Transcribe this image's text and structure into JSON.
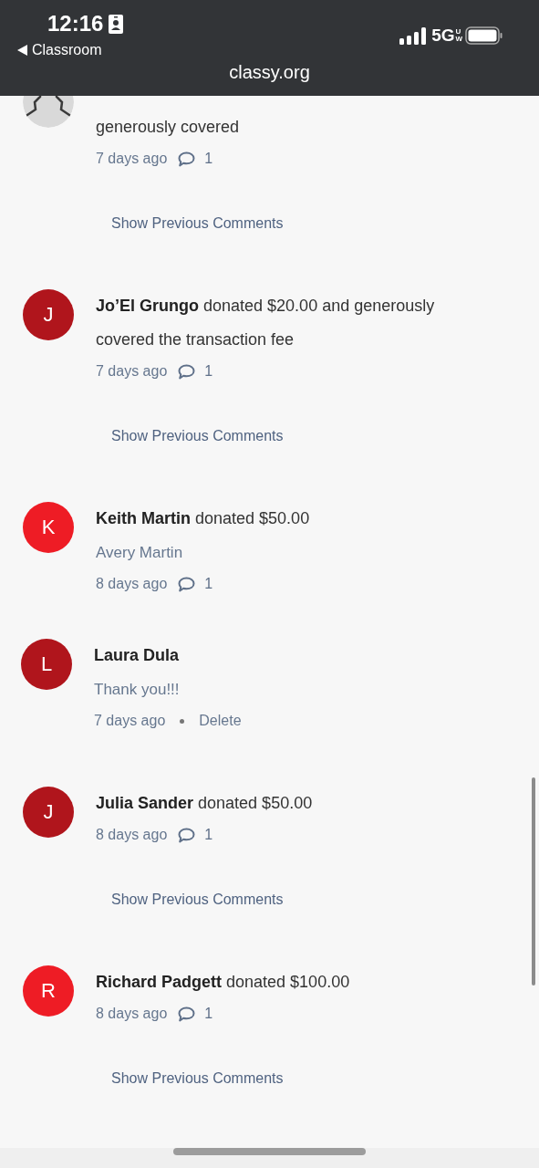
{
  "status_bar": {
    "time": "12:16",
    "back_label": "Classroom",
    "network": "5G",
    "network_badge": "UW"
  },
  "address_bar": {
    "url": "classy.org"
  },
  "feed": [
    {
      "kind": "anonymous",
      "text": "generously covered",
      "time": "7 days ago",
      "comment_count": "1",
      "show_previous": "Show Previous Comments"
    },
    {
      "kind": "donor",
      "initial": "J",
      "color": "#b0151c",
      "text": "**Jo’El Grungo** donated $20.00 and generously covered the transaction fee",
      "time": "7 days ago",
      "comment_count": "1",
      "show_previous": "Show Previous Comments"
    },
    {
      "kind": "donor",
      "initial": "K",
      "color": "#ee1c25",
      "text": "**Keith Martin** donated $50.00",
      "note": "Avery Martin",
      "time": "8 days ago",
      "comment_count": "1",
      "replies": [
        {
          "initial": "L",
          "color": "#b0151c",
          "name": "Laura Dula",
          "text": "Thank you!!!",
          "time": "7 days ago",
          "action": "Delete"
        }
      ]
    },
    {
      "kind": "donor",
      "initial": "J",
      "color": "#b0151c",
      "text": "**Julia Sander** donated $50.00",
      "time": "8 days ago",
      "comment_count": "1",
      "show_previous": "Show Previous Comments"
    },
    {
      "kind": "donor",
      "initial": "R",
      "color": "#ee1c25",
      "text": "**Richard Padgett** donated $100.00",
      "time": "8 days ago",
      "comment_count": "1",
      "show_previous": "Show Previous Comments"
    }
  ]
}
